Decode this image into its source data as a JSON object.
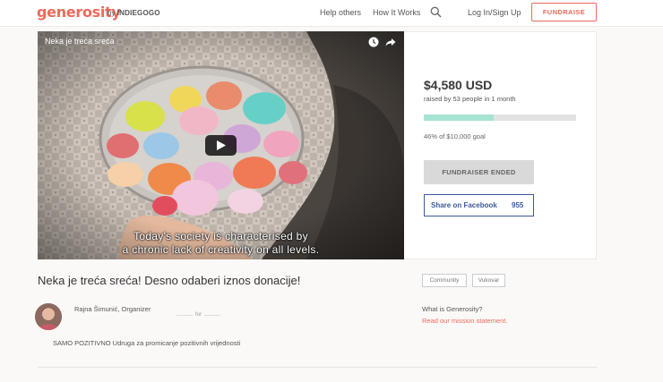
{
  "header": {
    "logo": "generosity",
    "by": "by",
    "by_brand": "INDIEGOGO",
    "nav": {
      "help_others": "Help others",
      "how_it_works": "How It Works",
      "login": "Log In/Sign Up",
      "fundraise": "FUNDRAISE"
    },
    "search_icon": "search-icon"
  },
  "video": {
    "title": "Neka je treća sreća",
    "subtitle_line1": "Today's society is characterised by",
    "subtitle_line2": "a chronic lack of creativity on all levels."
  },
  "campaign": {
    "amount": "$4,580 USD",
    "raised_text": "raised by 53 people in 1 month",
    "progress_percent": 46,
    "goal_text": "46% of $10,000 goal",
    "ended_label": "FUNDRAISER ENDED",
    "facebook_label": "Share on Facebook",
    "facebook_count": "955",
    "title": "Neka je treća sreća! Desno odaberi iznos donacije!",
    "organizer": "Rajna Šimunić, Organizer",
    "for_label": "for",
    "beneficiary": "SAMO POZITIVNO Udruga za promicanje pozitivnih vrijednosti",
    "tags": [
      "Community",
      "Vukovar"
    ],
    "what_is": "What is Generosity?",
    "mission_link": "Read our mission statement."
  },
  "colors": {
    "brand": "#eb6a5b",
    "progress": "#a6e3d2",
    "facebook": "#3b5998"
  }
}
